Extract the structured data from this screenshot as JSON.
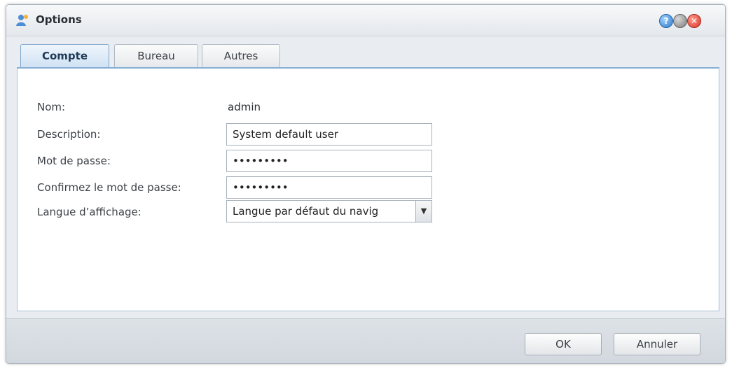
{
  "window": {
    "title": "Options",
    "help_symbol": "?",
    "close_symbol": "✕"
  },
  "tabs": [
    {
      "label": "Compte",
      "active": true
    },
    {
      "label": "Bureau",
      "active": false
    },
    {
      "label": "Autres",
      "active": false
    }
  ],
  "form": {
    "name_label": "Nom:",
    "name_value": "admin",
    "description_label": "Description:",
    "description_value": "System default user",
    "password_label": "Mot de passe:",
    "password_value": "•••••••••",
    "confirm_label": "Confirmez le mot de passe:",
    "confirm_value": "•••••••••",
    "language_label": "Langue d’affichage:",
    "language_value": "Langue par défaut du navig"
  },
  "buttons": {
    "ok": "OK",
    "cancel": "Annuler"
  }
}
